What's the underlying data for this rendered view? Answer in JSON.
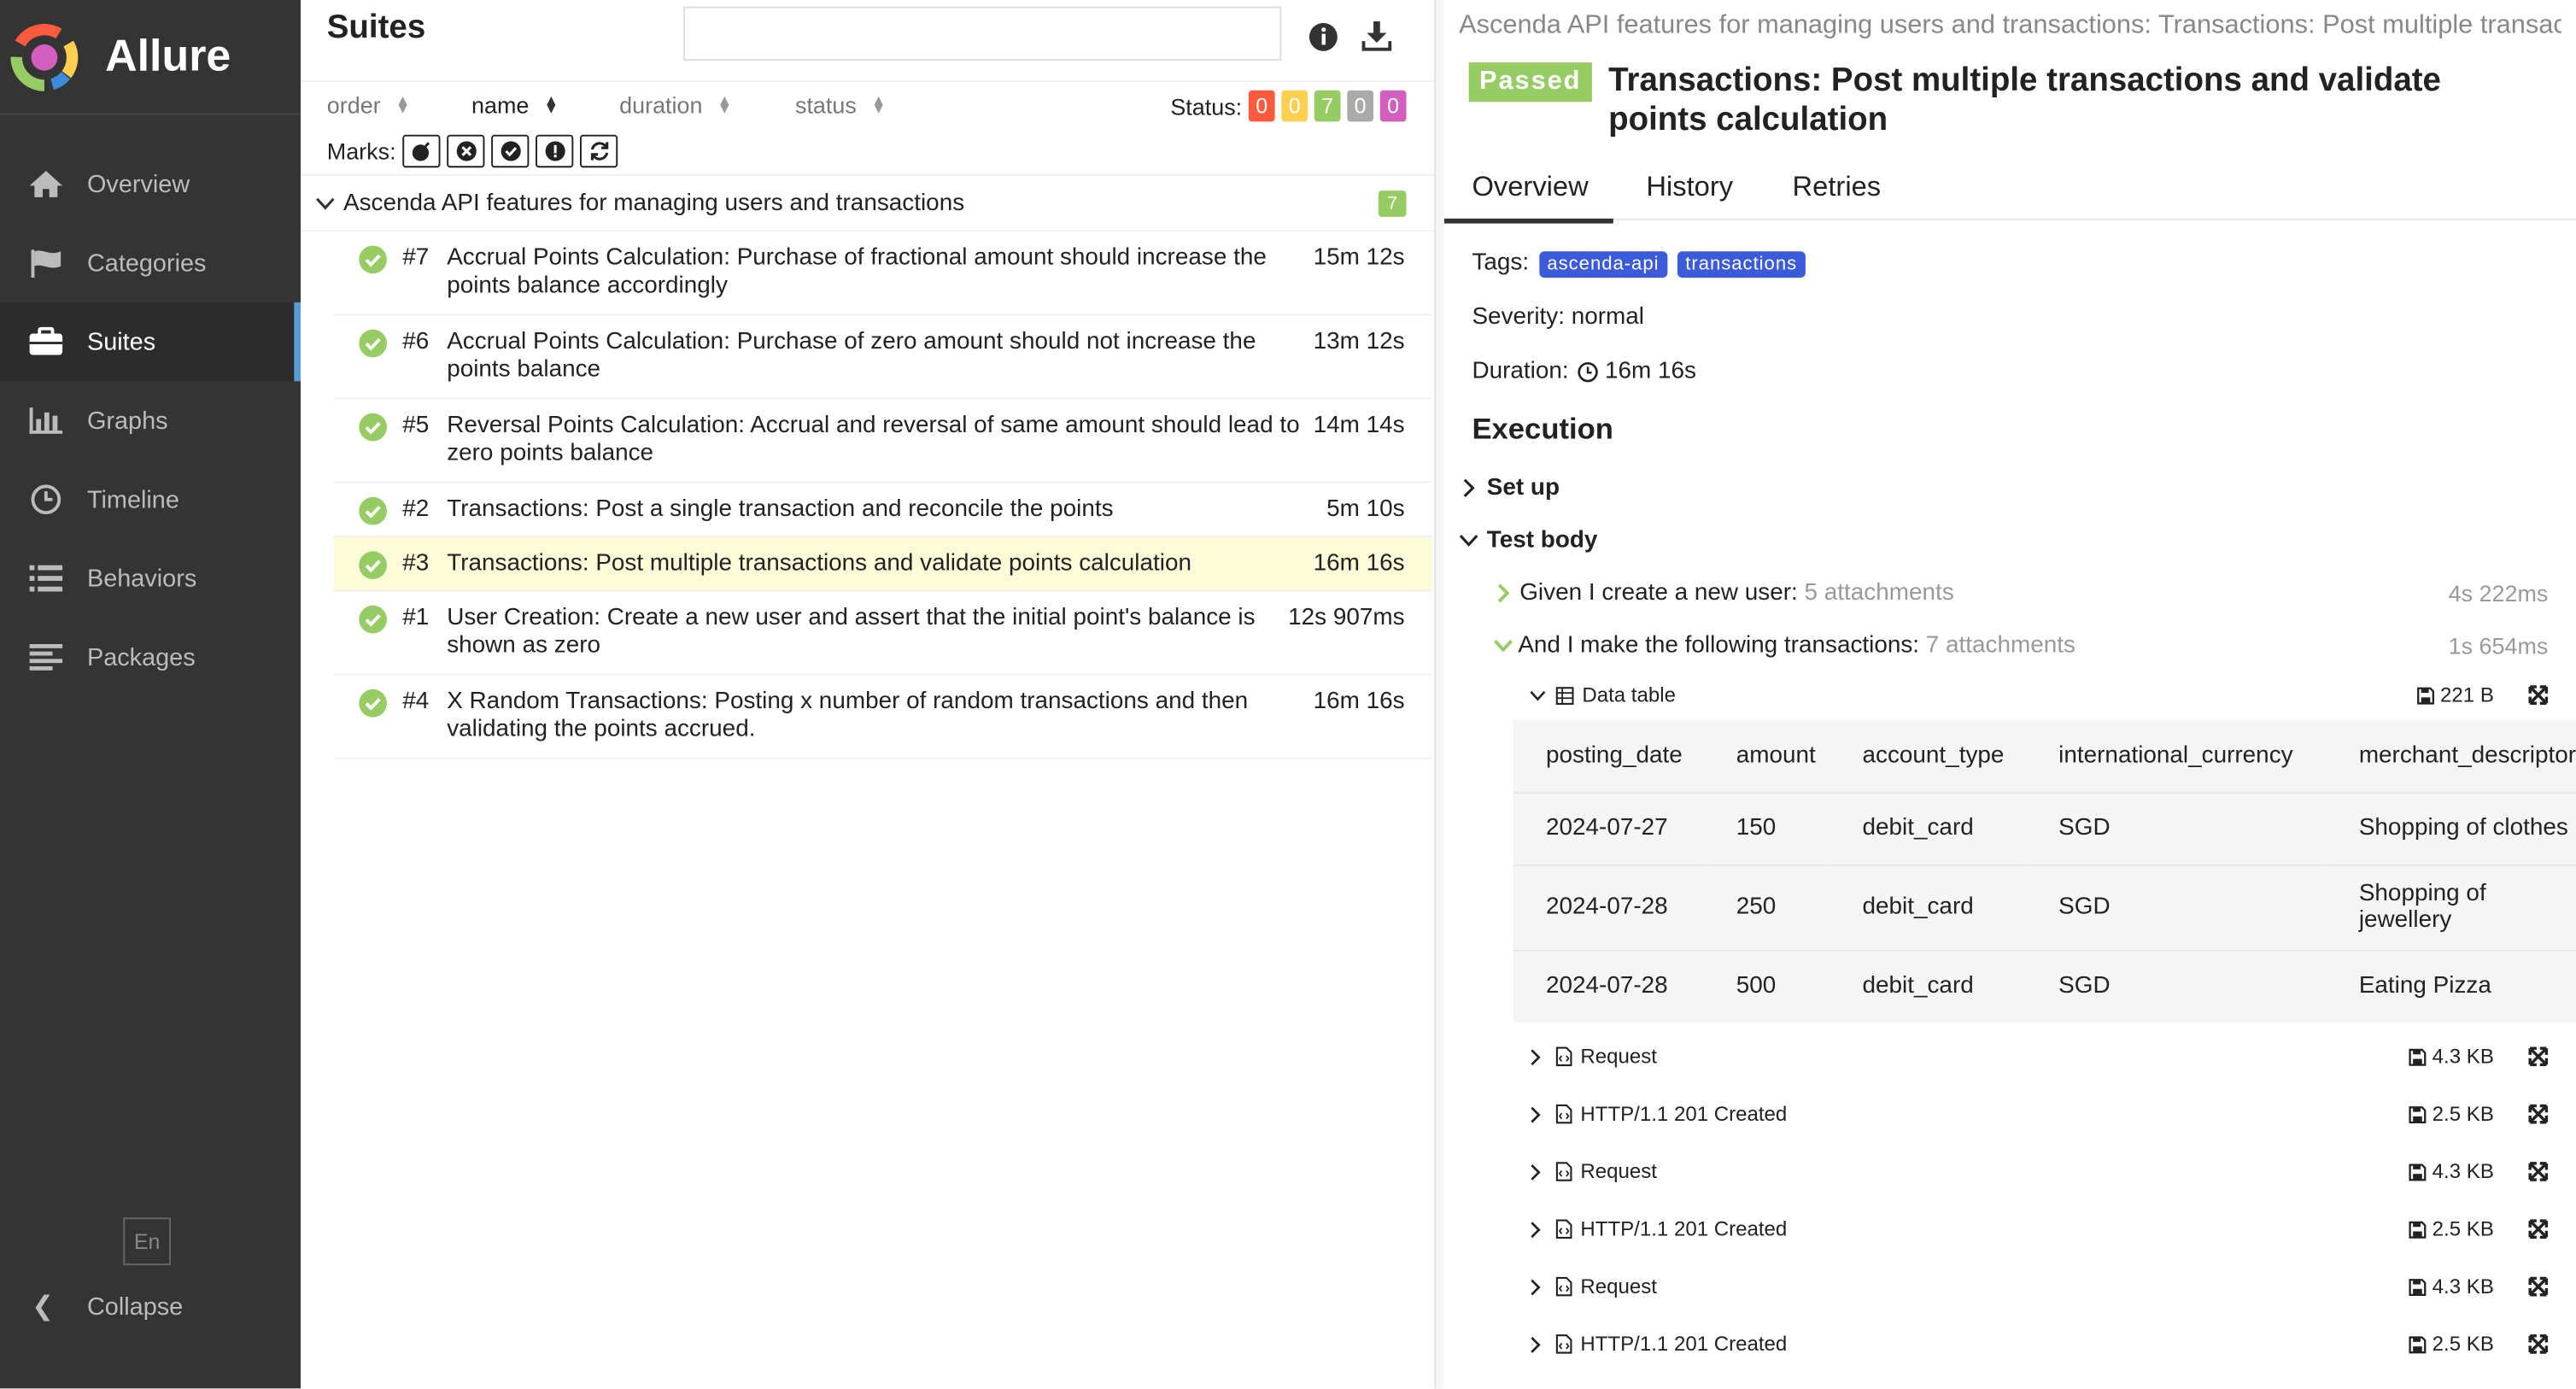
{
  "app": {
    "name": "Allure"
  },
  "sidebar": {
    "items": [
      {
        "label": "Overview",
        "icon": "home-icon"
      },
      {
        "label": "Categories",
        "icon": "flag-icon"
      },
      {
        "label": "Suites",
        "icon": "briefcase-icon",
        "active": true
      },
      {
        "label": "Graphs",
        "icon": "bar-chart-icon"
      },
      {
        "label": "Timeline",
        "icon": "clock-icon"
      },
      {
        "label": "Behaviors",
        "icon": "list-icon"
      },
      {
        "label": "Packages",
        "icon": "align-left-icon"
      }
    ],
    "language": "En",
    "collapse_label": "Collapse"
  },
  "suites": {
    "title": "Suites",
    "search_placeholder": "",
    "sort": {
      "order": "order",
      "name": "name",
      "duration": "duration",
      "status": "status"
    },
    "status_label": "Status:",
    "status_counts": [
      {
        "value": "0",
        "color": "#fd5a3e"
      },
      {
        "value": "0",
        "color": "#ffd050"
      },
      {
        "value": "7",
        "color": "#97cc64"
      },
      {
        "value": "0",
        "color": "#aaaaaa"
      },
      {
        "value": "0",
        "color": "#d35ebe"
      }
    ],
    "marks_label": "Marks:",
    "group": {
      "name": "Ascenda API features for managing users and transactions",
      "count": "7"
    },
    "cases": [
      {
        "num": "#7",
        "title": "Accrual Points Calculation: Purchase of fractional amount should increase the points balance accordingly",
        "duration": "15m 12s"
      },
      {
        "num": "#6",
        "title": "Accrual Points Calculation: Purchase of zero amount should not increase the points balance",
        "duration": "13m 12s"
      },
      {
        "num": "#5",
        "title": "Reversal Points Calculation: Accrual and reversal of same amount should lead to zero points balance",
        "duration": "14m 14s"
      },
      {
        "num": "#2",
        "title": "Transactions: Post a single transaction and reconcile the points",
        "duration": "5m 10s"
      },
      {
        "num": "#3",
        "title": "Transactions: Post multiple transactions and validate points calculation",
        "duration": "16m 16s",
        "selected": true
      },
      {
        "num": "#1",
        "title": "User Creation: Create a new user and assert that the initial point's balance is shown as zero",
        "duration": "12s 907ms"
      },
      {
        "num": "#4",
        "title": "X Random Transactions: Posting x number of random transactions and then validating the points accrued.",
        "duration": "16m 16s"
      }
    ]
  },
  "detail": {
    "breadcrumb": "Ascenda API features for managing users and transactions: Transactions: Post multiple transactions and validate points calculation",
    "status": "Passed",
    "title": "Transactions: Post multiple transactions and validate points calculation",
    "tabs": [
      "Overview",
      "History",
      "Retries"
    ],
    "tags_label": "Tags:",
    "tags": [
      "ascenda-api",
      "transactions"
    ],
    "severity": "Severity: normal",
    "duration_label": "Duration:",
    "duration": "16m 16s",
    "execution_title": "Execution",
    "setup_label": "Set up",
    "body_label": "Test body",
    "steps": [
      {
        "name": "Given I create a new user:",
        "attachments": "5 attachments",
        "duration": "4s 222ms"
      },
      {
        "name": "And I make the following transactions:",
        "attachments": "7 attachments",
        "duration": "1s 654ms"
      }
    ],
    "data_table": {
      "label": "Data table",
      "size": "221 B",
      "columns": [
        "posting_date",
        "amount",
        "account_type",
        "international_currency",
        "merchant_descriptor"
      ],
      "rows": [
        [
          "2024-07-27",
          "150",
          "debit_card",
          "SGD",
          "Shopping of clothes"
        ],
        [
          "2024-07-28",
          "250",
          "debit_card",
          "SGD",
          "Shopping of jewellery"
        ],
        [
          "2024-07-28",
          "500",
          "debit_card",
          "SGD",
          "Eating Pizza"
        ]
      ]
    },
    "attachments": [
      {
        "label": "Request",
        "size": "4.3 KB"
      },
      {
        "label": "HTTP/1.1 201 Created",
        "size": "2.5 KB"
      },
      {
        "label": "Request",
        "size": "4.3 KB"
      },
      {
        "label": "HTTP/1.1 201 Created",
        "size": "2.5 KB"
      },
      {
        "label": "Request",
        "size": "4.3 KB"
      },
      {
        "label": "HTTP/1.1 201 Created",
        "size": "2.5 KB"
      }
    ]
  }
}
